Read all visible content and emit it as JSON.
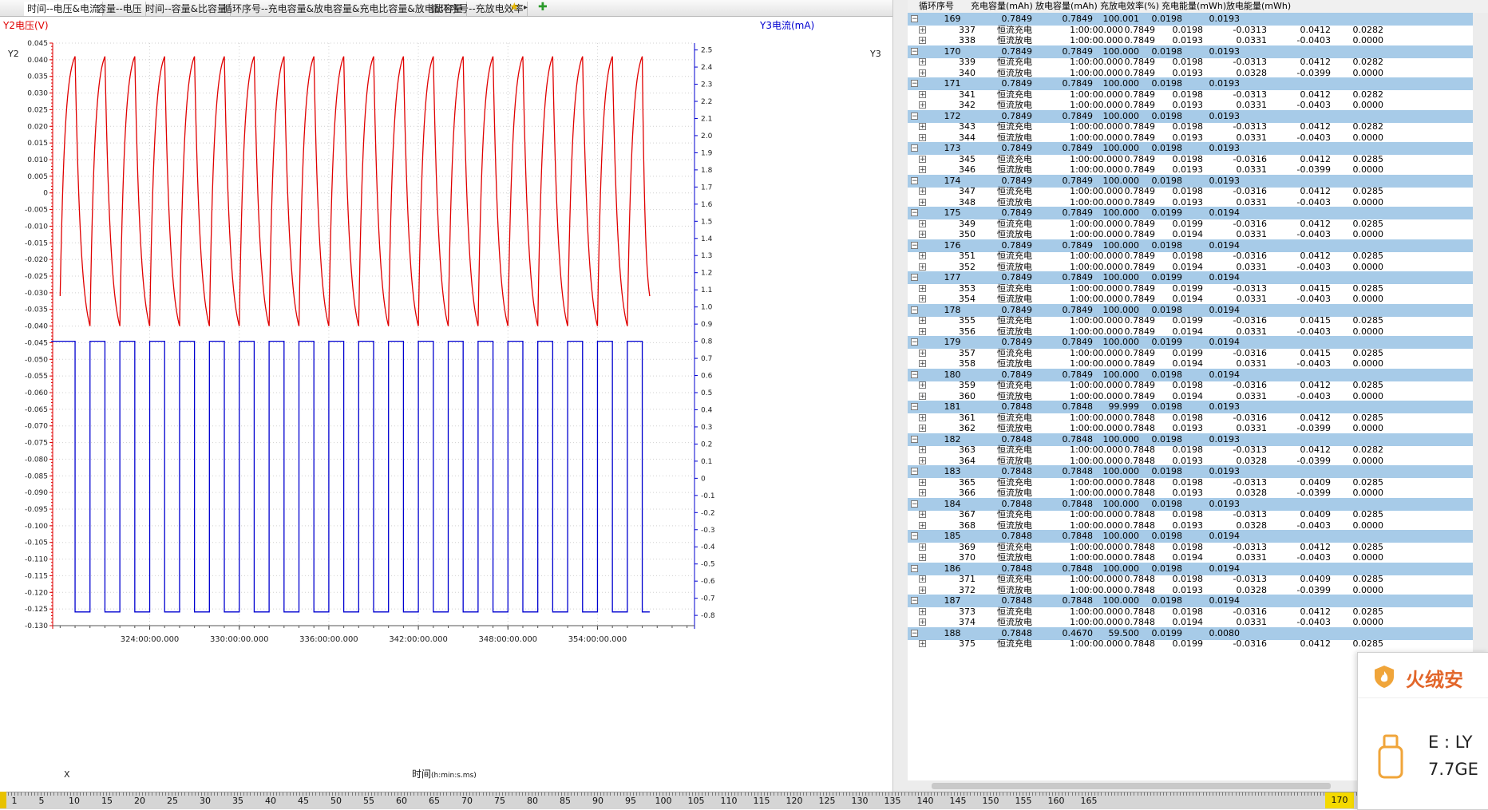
{
  "tabs": [
    {
      "label": "时间--电压&电流",
      "active": true
    },
    {
      "label": "容量--电压",
      "active": false
    },
    {
      "label": "时间--容量&比容量",
      "active": false
    },
    {
      "label": "循环序号--充电容量&放电容量&充电比容量&放电比容量",
      "active": false
    },
    {
      "label": "循环序号--充放电效率",
      "active": false
    }
  ],
  "tab_icons": [
    "star-icon",
    "arrow-right-icon",
    "add-chart-icon"
  ],
  "chart_data": {
    "type": "line",
    "y_left_title": "Y2电压(V)",
    "y_left_axis_name": "Y2",
    "y_right_title": "Y3电流(mA)",
    "y_right_axis_name": "Y3",
    "x_axis_name": "X",
    "xlabel": "时间",
    "xlabel_unit": "(h:min:s.ms)",
    "x_ticks": [
      "324:00:00.000",
      "330:00:00.000",
      "336:00:00.000",
      "342:00:00.000",
      "348:00:00.000",
      "354:00:00.000"
    ],
    "x_tick_hours": [
      324,
      330,
      336,
      342,
      348,
      354
    ],
    "x_range_hours": [
      317.5,
      360.5
    ],
    "y_left_ticks": [
      "0.045",
      "0.040",
      "0.035",
      "0.030",
      "0.025",
      "0.020",
      "0.015",
      "0.010",
      "0.005",
      "0",
      "-0.005",
      "-0.010",
      "-0.015",
      "-0.020",
      "-0.025",
      "-0.030",
      "-0.035",
      "-0.040",
      "-0.045",
      "-0.050",
      "-0.055",
      "-0.060",
      "-0.065",
      "-0.070",
      "-0.075",
      "-0.080",
      "-0.085",
      "-0.090",
      "-0.095",
      "-0.100",
      "-0.105",
      "-0.110",
      "-0.115",
      "-0.120",
      "-0.125",
      "-0.130"
    ],
    "y_left_range": [
      -0.13,
      0.045
    ],
    "y_right_ticks": [
      "2.5",
      "2.4",
      "2.3",
      "2.2",
      "2.1",
      "2.0",
      "1.9",
      "1.8",
      "1.7",
      "1.6",
      "1.5",
      "1.4",
      "1.3",
      "1.2",
      "1.1",
      "1.0",
      "0.9",
      "0.8",
      "0.7",
      "0.6",
      "0.5",
      "0.4",
      "0.3",
      "0.2",
      "0.1",
      "0",
      "-0.1",
      "-0.2",
      "-0.3",
      "-0.4",
      "-0.5",
      "-0.6",
      "-0.7",
      "-0.8"
    ],
    "y_right_range": [
      -0.86,
      2.54
    ],
    "grid": true,
    "series": [
      {
        "name": "Y2电压(V)",
        "color": "#e00000",
        "axis": "left",
        "v_min": -0.04,
        "v_max": 0.041,
        "v_start": -0.031,
        "v_end": -0.031
      },
      {
        "name": "Y3电流(mA)",
        "color": "#0000d0",
        "axis": "right",
        "i_charge": 0.8,
        "i_discharge": -0.78
      }
    ],
    "cycle_count": 20,
    "first_cycle_start_hour": 318.0,
    "cycle_period_hours": 2.0,
    "charge_hours": 1.0
  },
  "table": {
    "headers": [
      "循环序号",
      "充电容量(mAh)",
      "放电容量(mAh)",
      "充放电效率(%)",
      "充电能量(mWh)",
      "放电能量(mWh)"
    ],
    "cycles": [
      {
        "no": "169",
        "c": "0.7849",
        "d": "0.7849",
        "eff": "100.001",
        "ce": "0.0198",
        "de": "0.0193",
        "steps": [
          [
            "337",
            "恒流充电",
            "1:00:00.000",
            "0.7849",
            "0.0198",
            "-0.0313",
            "0.0412",
            "0.0282"
          ],
          [
            "338",
            "恒流放电",
            "1:00:00.000",
            "0.7849",
            "0.0193",
            "0.0331",
            "-0.0403",
            "0.0000"
          ]
        ]
      },
      {
        "no": "170",
        "c": "0.7849",
        "d": "0.7849",
        "eff": "100.000",
        "ce": "0.0198",
        "de": "0.0193",
        "steps": [
          [
            "339",
            "恒流充电",
            "1:00:00.000",
            "0.7849",
            "0.0198",
            "-0.0313",
            "0.0412",
            "0.0282"
          ],
          [
            "340",
            "恒流放电",
            "1:00:00.000",
            "0.7849",
            "0.0193",
            "0.0328",
            "-0.0399",
            "0.0000"
          ]
        ]
      },
      {
        "no": "171",
        "c": "0.7849",
        "d": "0.7849",
        "eff": "100.000",
        "ce": "0.0198",
        "de": "0.0193",
        "steps": [
          [
            "341",
            "恒流充电",
            "1:00:00.000",
            "0.7849",
            "0.0198",
            "-0.0313",
            "0.0412",
            "0.0282"
          ],
          [
            "342",
            "恒流放电",
            "1:00:00.000",
            "0.7849",
            "0.0193",
            "0.0331",
            "-0.0403",
            "0.0000"
          ]
        ]
      },
      {
        "no": "172",
        "c": "0.7849",
        "d": "0.7849",
        "eff": "100.000",
        "ce": "0.0198",
        "de": "0.0193",
        "steps": [
          [
            "343",
            "恒流充电",
            "1:00:00.000",
            "0.7849",
            "0.0198",
            "-0.0313",
            "0.0412",
            "0.0282"
          ],
          [
            "344",
            "恒流放电",
            "1:00:00.000",
            "0.7849",
            "0.0193",
            "0.0331",
            "-0.0403",
            "0.0000"
          ]
        ]
      },
      {
        "no": "173",
        "c": "0.7849",
        "d": "0.7849",
        "eff": "100.000",
        "ce": "0.0198",
        "de": "0.0193",
        "steps": [
          [
            "345",
            "恒流充电",
            "1:00:00.000",
            "0.7849",
            "0.0198",
            "-0.0316",
            "0.0412",
            "0.0285"
          ],
          [
            "346",
            "恒流放电",
            "1:00:00.000",
            "0.7849",
            "0.0193",
            "0.0331",
            "-0.0399",
            "0.0000"
          ]
        ]
      },
      {
        "no": "174",
        "c": "0.7849",
        "d": "0.7849",
        "eff": "100.000",
        "ce": "0.0198",
        "de": "0.0193",
        "steps": [
          [
            "347",
            "恒流充电",
            "1:00:00.000",
            "0.7849",
            "0.0198",
            "-0.0316",
            "0.0412",
            "0.0285"
          ],
          [
            "348",
            "恒流放电",
            "1:00:00.000",
            "0.7849",
            "0.0193",
            "0.0331",
            "-0.0403",
            "0.0000"
          ]
        ]
      },
      {
        "no": "175",
        "c": "0.7849",
        "d": "0.7849",
        "eff": "100.000",
        "ce": "0.0199",
        "de": "0.0194",
        "steps": [
          [
            "349",
            "恒流充电",
            "1:00:00.000",
            "0.7849",
            "0.0199",
            "-0.0316",
            "0.0412",
            "0.0285"
          ],
          [
            "350",
            "恒流放电",
            "1:00:00.000",
            "0.7849",
            "0.0194",
            "0.0331",
            "-0.0403",
            "0.0000"
          ]
        ]
      },
      {
        "no": "176",
        "c": "0.7849",
        "d": "0.7849",
        "eff": "100.000",
        "ce": "0.0198",
        "de": "0.0194",
        "steps": [
          [
            "351",
            "恒流充电",
            "1:00:00.000",
            "0.7849",
            "0.0198",
            "-0.0316",
            "0.0412",
            "0.0285"
          ],
          [
            "352",
            "恒流放电",
            "1:00:00.000",
            "0.7849",
            "0.0194",
            "0.0331",
            "-0.0403",
            "0.0000"
          ]
        ]
      },
      {
        "no": "177",
        "c": "0.7849",
        "d": "0.7849",
        "eff": "100.000",
        "ce": "0.0199",
        "de": "0.0194",
        "steps": [
          [
            "353",
            "恒流充电",
            "1:00:00.000",
            "0.7849",
            "0.0199",
            "-0.0313",
            "0.0415",
            "0.0285"
          ],
          [
            "354",
            "恒流放电",
            "1:00:00.000",
            "0.7849",
            "0.0194",
            "0.0331",
            "-0.0403",
            "0.0000"
          ]
        ]
      },
      {
        "no": "178",
        "c": "0.7849",
        "d": "0.7849",
        "eff": "100.000",
        "ce": "0.0198",
        "de": "0.0194",
        "steps": [
          [
            "355",
            "恒流充电",
            "1:00:00.000",
            "0.7849",
            "0.0199",
            "-0.0316",
            "0.0415",
            "0.0285"
          ],
          [
            "356",
            "恒流放电",
            "1:00:00.000",
            "0.7849",
            "0.0194",
            "0.0331",
            "-0.0403",
            "0.0000"
          ]
        ]
      },
      {
        "no": "179",
        "c": "0.7849",
        "d": "0.7849",
        "eff": "100.000",
        "ce": "0.0199",
        "de": "0.0194",
        "steps": [
          [
            "357",
            "恒流充电",
            "1:00:00.000",
            "0.7849",
            "0.0199",
            "-0.0316",
            "0.0415",
            "0.0285"
          ],
          [
            "358",
            "恒流放电",
            "1:00:00.000",
            "0.7849",
            "0.0194",
            "0.0331",
            "-0.0403",
            "0.0000"
          ]
        ]
      },
      {
        "no": "180",
        "c": "0.7849",
        "d": "0.7849",
        "eff": "100.000",
        "ce": "0.0198",
        "de": "0.0194",
        "steps": [
          [
            "359",
            "恒流充电",
            "1:00:00.000",
            "0.7849",
            "0.0198",
            "-0.0316",
            "0.0412",
            "0.0285"
          ],
          [
            "360",
            "恒流放电",
            "1:00:00.000",
            "0.7849",
            "0.0194",
            "0.0331",
            "-0.0403",
            "0.0000"
          ]
        ]
      },
      {
        "no": "181",
        "c": "0.7848",
        "d": "0.7848",
        "eff": "99.999",
        "ce": "0.0198",
        "de": "0.0193",
        "steps": [
          [
            "361",
            "恒流充电",
            "1:00:00.000",
            "0.7848",
            "0.0198",
            "-0.0316",
            "0.0412",
            "0.0285"
          ],
          [
            "362",
            "恒流放电",
            "1:00:00.000",
            "0.7848",
            "0.0193",
            "0.0331",
            "-0.0399",
            "0.0000"
          ]
        ]
      },
      {
        "no": "182",
        "c": "0.7848",
        "d": "0.7848",
        "eff": "100.000",
        "ce": "0.0198",
        "de": "0.0193",
        "steps": [
          [
            "363",
            "恒流充电",
            "1:00:00.000",
            "0.7848",
            "0.0198",
            "-0.0313",
            "0.0412",
            "0.0282"
          ],
          [
            "364",
            "恒流放电",
            "1:00:00.000",
            "0.7848",
            "0.0193",
            "0.0328",
            "-0.0399",
            "0.0000"
          ]
        ]
      },
      {
        "no": "183",
        "c": "0.7848",
        "d": "0.7848",
        "eff": "100.000",
        "ce": "0.0198",
        "de": "0.0193",
        "steps": [
          [
            "365",
            "恒流充电",
            "1:00:00.000",
            "0.7848",
            "0.0198",
            "-0.0313",
            "0.0409",
            "0.0285"
          ],
          [
            "366",
            "恒流放电",
            "1:00:00.000",
            "0.7848",
            "0.0193",
            "0.0328",
            "-0.0399",
            "0.0000"
          ]
        ]
      },
      {
        "no": "184",
        "c": "0.7848",
        "d": "0.7848",
        "eff": "100.000",
        "ce": "0.0198",
        "de": "0.0193",
        "steps": [
          [
            "367",
            "恒流充电",
            "1:00:00.000",
            "0.7848",
            "0.0198",
            "-0.0313",
            "0.0409",
            "0.0285"
          ],
          [
            "368",
            "恒流放电",
            "1:00:00.000",
            "0.7848",
            "0.0193",
            "0.0328",
            "-0.0403",
            "0.0000"
          ]
        ]
      },
      {
        "no": "185",
        "c": "0.7848",
        "d": "0.7848",
        "eff": "100.000",
        "ce": "0.0198",
        "de": "0.0194",
        "steps": [
          [
            "369",
            "恒流充电",
            "1:00:00.000",
            "0.7848",
            "0.0198",
            "-0.0313",
            "0.0412",
            "0.0285"
          ],
          [
            "370",
            "恒流放电",
            "1:00:00.000",
            "0.7848",
            "0.0194",
            "0.0331",
            "-0.0403",
            "0.0000"
          ]
        ]
      },
      {
        "no": "186",
        "c": "0.7848",
        "d": "0.7848",
        "eff": "100.000",
        "ce": "0.0198",
        "de": "0.0194",
        "steps": [
          [
            "371",
            "恒流充电",
            "1:00:00.000",
            "0.7848",
            "0.0198",
            "-0.0313",
            "0.0409",
            "0.0285"
          ],
          [
            "372",
            "恒流放电",
            "1:00:00.000",
            "0.7848",
            "0.0193",
            "0.0328",
            "-0.0399",
            "0.0000"
          ]
        ]
      },
      {
        "no": "187",
        "c": "0.7848",
        "d": "0.7848",
        "eff": "100.000",
        "ce": "0.0198",
        "de": "0.0194",
        "steps": [
          [
            "373",
            "恒流充电",
            "1:00:00.000",
            "0.7848",
            "0.0198",
            "-0.0316",
            "0.0412",
            "0.0285"
          ],
          [
            "374",
            "恒流放电",
            "1:00:00.000",
            "0.7848",
            "0.0194",
            "0.0331",
            "-0.0403",
            "0.0000"
          ]
        ]
      },
      {
        "no": "188",
        "c": "0.7848",
        "d": "0.4670",
        "eff": "59.500",
        "ce": "0.0199",
        "de": "0.0080",
        "steps": [
          [
            "375",
            "恒流充电",
            "1:00:00.000",
            "0.7848",
            "0.0199",
            "-0.0316",
            "0.0412",
            "0.0285"
          ]
        ]
      }
    ]
  },
  "ruler": {
    "ticks": [
      "1",
      "5",
      "10",
      "15",
      "20",
      "25",
      "30",
      "35",
      "40",
      "45",
      "50",
      "55",
      "60",
      "65",
      "70",
      "75",
      "80",
      "85",
      "90",
      "95",
      "100",
      "105",
      "110",
      "115",
      "120",
      "125",
      "130",
      "135",
      "140",
      "145",
      "150",
      "155",
      "160",
      "165",
      "170"
    ],
    "selected": "170"
  },
  "popup": {
    "brand": "火绒安",
    "drive": "E : LY",
    "capacity": "7.7GE"
  },
  "colors": {
    "voltage": "#e00000",
    "current": "#0000d0",
    "cycle_row": "#a7cbe8",
    "brand": "#e2662a"
  }
}
